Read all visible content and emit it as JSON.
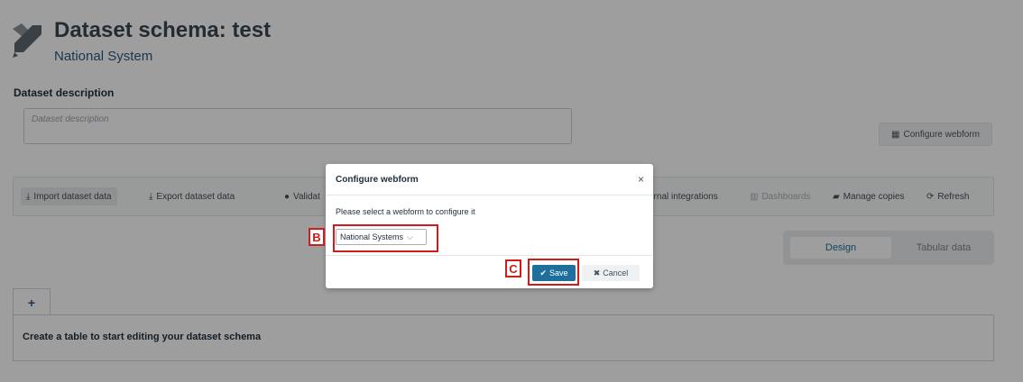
{
  "header": {
    "title": "Dataset schema: test",
    "subtitle": "National System"
  },
  "description": {
    "label": "Dataset description",
    "placeholder": "Dataset description"
  },
  "configure_webform_button": "Configure webform",
  "toolbar": {
    "items": [
      {
        "icon": "import-icon",
        "label": "Import dataset data"
      },
      {
        "icon": "export-icon",
        "label": "Export dataset data"
      },
      {
        "icon": "check-circle-icon",
        "label": "Validat"
      },
      {
        "icon": "",
        "label": "ernal integrations"
      },
      {
        "icon": "chart-icon",
        "label": "Dashboards"
      },
      {
        "icon": "copies-icon",
        "label": "Manage copies"
      },
      {
        "icon": "refresh-icon",
        "label": "Refresh"
      }
    ]
  },
  "view_tabs": [
    "Design",
    "Tabular data"
  ],
  "add_tab_label": "+",
  "empty_table_message": "Create a table to start editing your dataset schema",
  "dialog": {
    "title": "Configure webform",
    "close_glyph": "×",
    "prompt": "Please select a webform to configure it",
    "select_value": "National Systems",
    "save_label": "Save",
    "cancel_label": "Cancel"
  },
  "callouts": [
    "B",
    "C"
  ],
  "colors": {
    "primary": "#1f6f9c",
    "callout": "#d21b1b",
    "overlay": "rgba(0,0,0,0.38)"
  }
}
